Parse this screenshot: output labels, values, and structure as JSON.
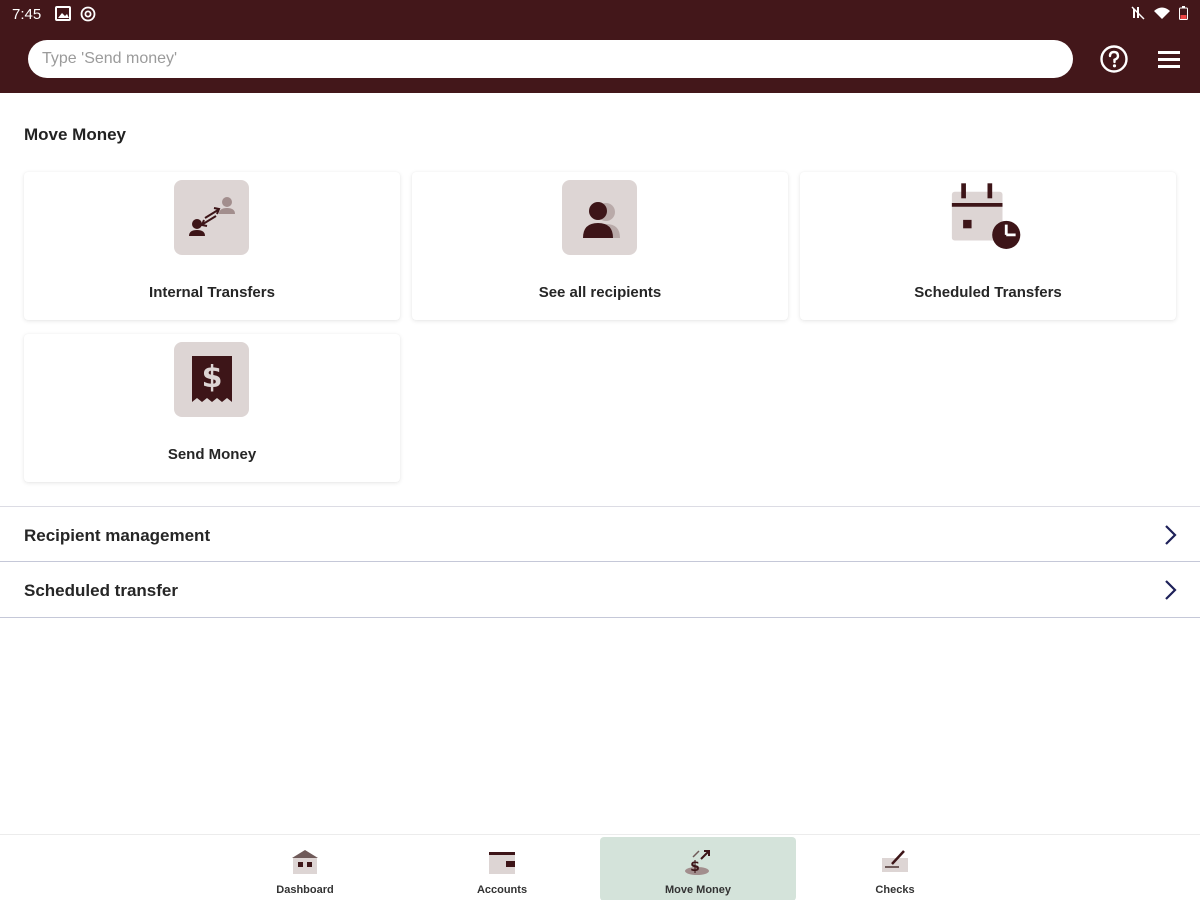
{
  "status_bar": {
    "time": "7:45",
    "left_icons": [
      "image-icon",
      "at-icon"
    ],
    "right_icons": [
      "mute-icon",
      "wifi-icon",
      "battery-icon"
    ]
  },
  "header": {
    "search": {
      "placeholder": "Type 'Send money'",
      "value": ""
    },
    "help_icon": "help-circle-icon",
    "menu_icon": "hamburger-menu-icon",
    "background_color": "#43171a"
  },
  "main": {
    "section_title": "Move Money",
    "cards": [
      {
        "label": "Internal Transfers",
        "icon": "internal-transfer-icon"
      },
      {
        "label": "See all recipients",
        "icon": "recipients-icon"
      },
      {
        "label": "Scheduled Transfers",
        "icon": "calendar-clock-icon"
      },
      {
        "label": "Send Money",
        "icon": "dollar-receipt-icon"
      }
    ],
    "rows": [
      {
        "label": "Recipient management"
      },
      {
        "label": "Scheduled transfer"
      }
    ]
  },
  "bottom_nav": {
    "items": [
      {
        "label": "Dashboard",
        "icon": "bank-icon",
        "active": false
      },
      {
        "label": "Accounts",
        "icon": "wallet-icon",
        "active": false
      },
      {
        "label": "Move Money",
        "icon": "move-money-icon",
        "active": true
      },
      {
        "label": "Checks",
        "icon": "check-deposit-icon",
        "active": false
      }
    ],
    "active_color": "#d4e3da"
  },
  "colors": {
    "brand_dark": "#43171a",
    "tile_bg": "#ddd5d4",
    "chevron": "#1e2159"
  }
}
